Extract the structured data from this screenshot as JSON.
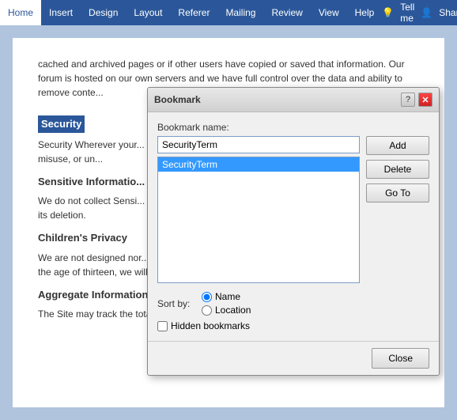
{
  "ribbon": {
    "tabs": [
      {
        "label": "Home",
        "active": false
      },
      {
        "label": "Insert",
        "active": false
      },
      {
        "label": "Design",
        "active": false
      },
      {
        "label": "Layout",
        "active": false
      },
      {
        "label": "Referer",
        "active": false
      },
      {
        "label": "Mailing",
        "active": false
      },
      {
        "label": "Review",
        "active": false
      },
      {
        "label": "View",
        "active": false
      },
      {
        "label": "Help",
        "active": false
      }
    ],
    "tell_me": "Tell me",
    "share": "Share"
  },
  "document": {
    "paragraphs": [
      "cached and archived pages or if other users have copied or saved that information. Our forum is hosted on our own servers and we have full control over the data and ability to remove conte...",
      "Security Wherever your... our behalf, reasonable a... like technologies, are an... from loss, misuse, or un...",
      "We do not collect Sensi... political, religious, philo... If we are made aware th... proceed to its deletion.",
      "We are not designed nor... to collect Personal Infor... we are made aware that ... child under the age of thirteen, we will promptly delete that information.",
      "The Site may track the total number of visitors to our Site, the number of visitors to"
    ],
    "headings": [
      {
        "text": "Security",
        "style": "highlighted"
      },
      {
        "text": "Sensitive Informatio...",
        "style": "normal"
      },
      {
        "text": "Children's Privacy",
        "style": "normal"
      },
      {
        "text": "Aggregate Information",
        "style": "normal"
      }
    ]
  },
  "dialog": {
    "title": "Bookmark",
    "help_tooltip": "?",
    "close_icon": "✕",
    "bookmark_name_label": "Bookmark name:",
    "bookmark_name_value": "SecurityTerm",
    "bookmarks": [
      {
        "label": "SecurityTerm",
        "selected": true
      }
    ],
    "buttons": {
      "add": "Add",
      "delete": "Delete",
      "go_to": "Go To"
    },
    "sort_by_label": "Sort by:",
    "sort_options": [
      {
        "label": "Name",
        "selected": true
      },
      {
        "label": "Location",
        "selected": false
      }
    ],
    "hidden_bookmarks_label": "Hidden bookmarks",
    "hidden_bookmarks_checked": false,
    "close_button": "Close"
  }
}
